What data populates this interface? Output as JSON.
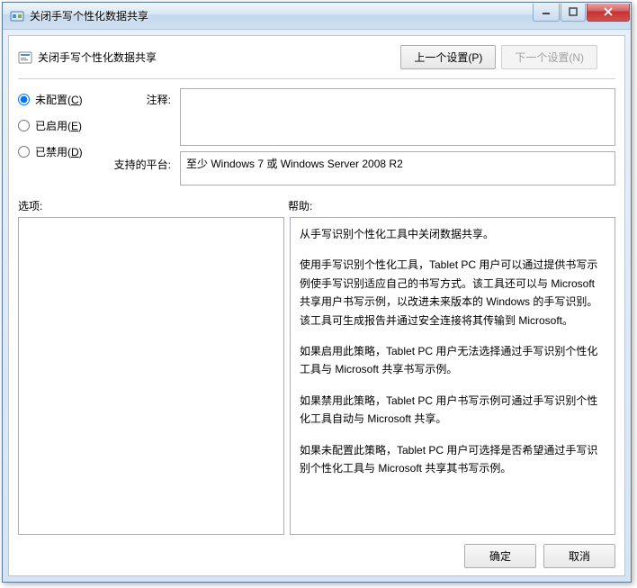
{
  "window": {
    "title": "关闭手写个性化数据共享"
  },
  "header": {
    "title": "关闭手写个性化数据共享",
    "prev_button": "上一个设置(P)",
    "next_button": "下一个设置(N)"
  },
  "radios": {
    "not_configured": "未配置(",
    "not_configured_key": "C",
    "not_configured_suffix": ")",
    "enabled": "已启用(",
    "enabled_key": "E",
    "enabled_suffix": ")",
    "disabled": "已禁用(",
    "disabled_key": "D",
    "disabled_suffix": ")"
  },
  "labels": {
    "comment": "注释:",
    "platform": "支持的平台:",
    "options": "选项:",
    "help": "帮助:"
  },
  "fields": {
    "comment_value": "",
    "platform_value": "至少 Windows 7 或 Windows Server 2008 R2"
  },
  "help": {
    "p1": "从手写识别个性化工具中关闭数据共享。",
    "p2": "使用手写识别个性化工具，Tablet PC 用户可以通过提供书写示例使手写识别适应自己的书写方式。该工具还可以与 Microsoft 共享用户书写示例，以改进未来版本的 Windows 的手写识别。该工具可生成报告并通过安全连接将其传输到 Microsoft。",
    "p3": "如果启用此策略，Tablet PC 用户无法选择通过手写识别个性化工具与 Microsoft 共享书写示例。",
    "p4": "如果禁用此策略，Tablet PC 用户书写示例可通过手写识别个性化工具自动与 Microsoft 共享。",
    "p5": "如果未配置此策略，Tablet PC 用户可选择是否希望通过手写识别个性化工具与 Microsoft 共享其书写示例。"
  },
  "footer": {
    "ok": "确定",
    "cancel": "取消"
  }
}
